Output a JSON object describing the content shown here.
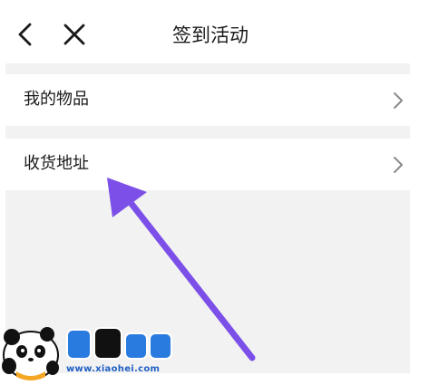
{
  "header": {
    "title": "签到活动",
    "back_icon": "chevron-left-icon",
    "close_icon": "close-icon"
  },
  "list": {
    "items": [
      {
        "label": "我的物品",
        "icon": "chevron-right-icon"
      },
      {
        "label": "收货地址",
        "icon": "chevron-right-icon"
      }
    ]
  },
  "annotation": {
    "arrow_color": "#7b4fe8"
  },
  "watermark": {
    "brand": "小黑游戏",
    "url": "www.xiaohei.com"
  }
}
